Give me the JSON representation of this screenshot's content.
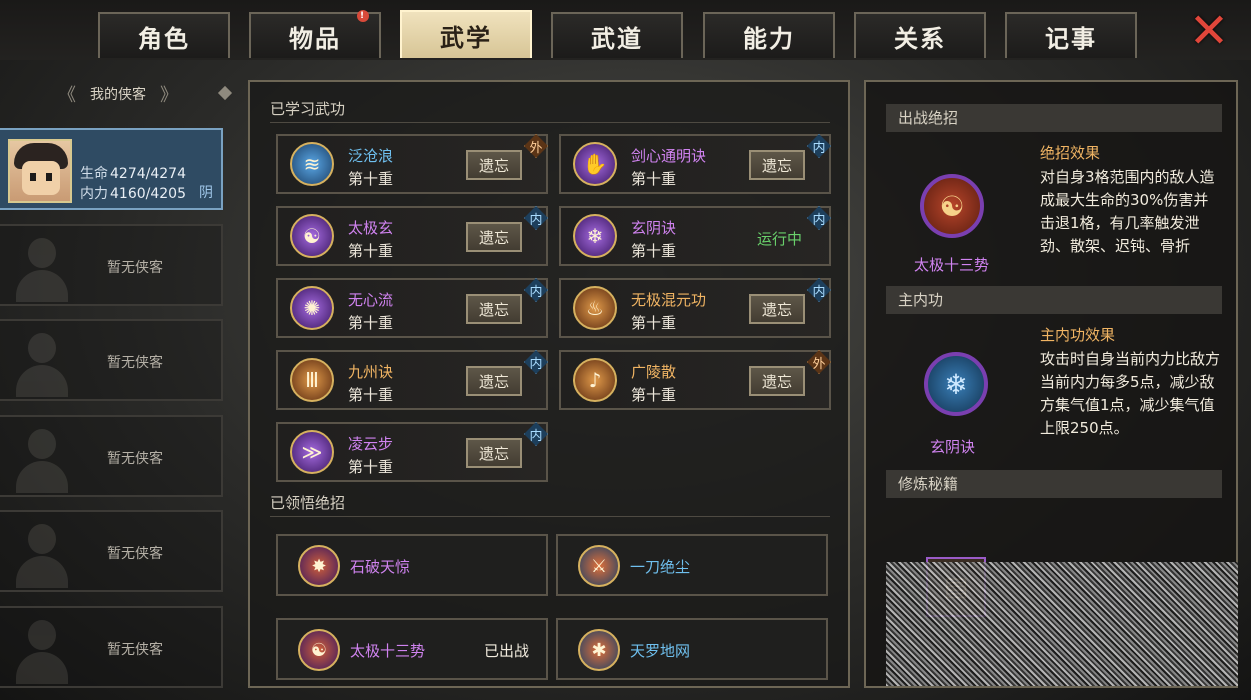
{
  "tabs": [
    {
      "label": "角色",
      "active": false,
      "notify": false
    },
    {
      "label": "物品",
      "active": false,
      "notify": true
    },
    {
      "label": "武学",
      "active": true,
      "notify": false
    },
    {
      "label": "武道",
      "active": false,
      "notify": false
    },
    {
      "label": "能力",
      "active": false,
      "notify": false
    },
    {
      "label": "关系",
      "active": false,
      "notify": false
    },
    {
      "label": "记事",
      "active": false,
      "notify": false
    }
  ],
  "notify_mark": "!",
  "close_icon": "✕",
  "left": {
    "header": "我的侠客",
    "character": {
      "hp_label": "生命",
      "hp_value": "4274/4274",
      "mp_label": "内力",
      "mp_value": "4160/4205",
      "alignment": "阴"
    },
    "empty_slots": [
      "暂无侠客",
      "暂无侠客",
      "暂无侠客",
      "暂无侠客",
      "暂无侠客"
    ]
  },
  "middle": {
    "learned_title": "已学习武功",
    "skills": [
      {
        "name": "泛沧浪",
        "level": "第十重",
        "action": "遗忘",
        "tag": "外",
        "tag_type": "wai",
        "color": "blue",
        "icon": "wave-icon",
        "glyph": "≋"
      },
      {
        "name": "剑心通明诀",
        "level": "第十重",
        "action": "遗忘",
        "tag": "内",
        "tag_type": "nei",
        "color": "purple",
        "icon": "flame-hand-icon",
        "glyph": "✋"
      },
      {
        "name": "太极玄",
        "level": "第十重",
        "action": "遗忘",
        "tag": "内",
        "tag_type": "nei",
        "color": "purple",
        "icon": "taiji-icon",
        "glyph": "☯"
      },
      {
        "name": "玄阴诀",
        "level": "第十重",
        "action": "运行中",
        "tag": "内",
        "tag_type": "nei",
        "color": "purple",
        "icon": "crack-orb-icon",
        "glyph": "❄",
        "running": true
      },
      {
        "name": "无心流",
        "level": "第十重",
        "action": "遗忘",
        "tag": "内",
        "tag_type": "nei",
        "color": "purple",
        "icon": "blue-flame-icon",
        "glyph": "✺"
      },
      {
        "name": "无极混元功",
        "level": "第十重",
        "action": "遗忘",
        "tag": "内",
        "tag_type": "nei",
        "color": "orange",
        "icon": "pillar-icon",
        "glyph": "♨"
      },
      {
        "name": "九州诀",
        "level": "第十重",
        "action": "遗忘",
        "tag": "内",
        "tag_type": "nei",
        "color": "orange",
        "icon": "columns-icon",
        "glyph": "Ⅲ"
      },
      {
        "name": "广陵散",
        "level": "第十重",
        "action": "遗忘",
        "tag": "外",
        "tag_type": "wai",
        "color": "orange",
        "icon": "zither-icon",
        "glyph": "♪"
      },
      {
        "name": "凌云步",
        "level": "第十重",
        "action": "遗忘",
        "tag": "内",
        "tag_type": "nei",
        "color": "purple",
        "icon": "wing-icon",
        "glyph": "≫"
      }
    ],
    "ult_title": "已领悟绝招",
    "ults": [
      {
        "name": "石破天惊",
        "color": "purple",
        "icon": "burst-icon",
        "glyph": "✸",
        "status": ""
      },
      {
        "name": "一刀绝尘",
        "color": "blue",
        "icon": "blade-icon",
        "glyph": "⚔",
        "status": ""
      },
      {
        "name": "太极十三势",
        "color": "purple",
        "icon": "taiji-icon",
        "glyph": "☯",
        "status": "已出战"
      },
      {
        "name": "天罗地网",
        "color": "blue",
        "icon": "net-icon",
        "glyph": "✱",
        "status": ""
      }
    ]
  },
  "right": {
    "battle_title": "出战绝招",
    "battle_name": "太极十三势",
    "battle_effect_title": "绝招效果",
    "battle_effect_text": "对自身3格范围内的敌人造成最大生命的30%伤害并击退1格，有几率触发泄劲、散架、迟钝、骨折",
    "main_title": "主内功",
    "main_name": "玄阴诀",
    "main_effect_title": "主内功效果",
    "main_effect_text": "攻击时自身当前内力比敌方当前内力每多5点，减少敌方集气值1点，减少集气值上限250点。",
    "practice_title": "修炼秘籍"
  }
}
